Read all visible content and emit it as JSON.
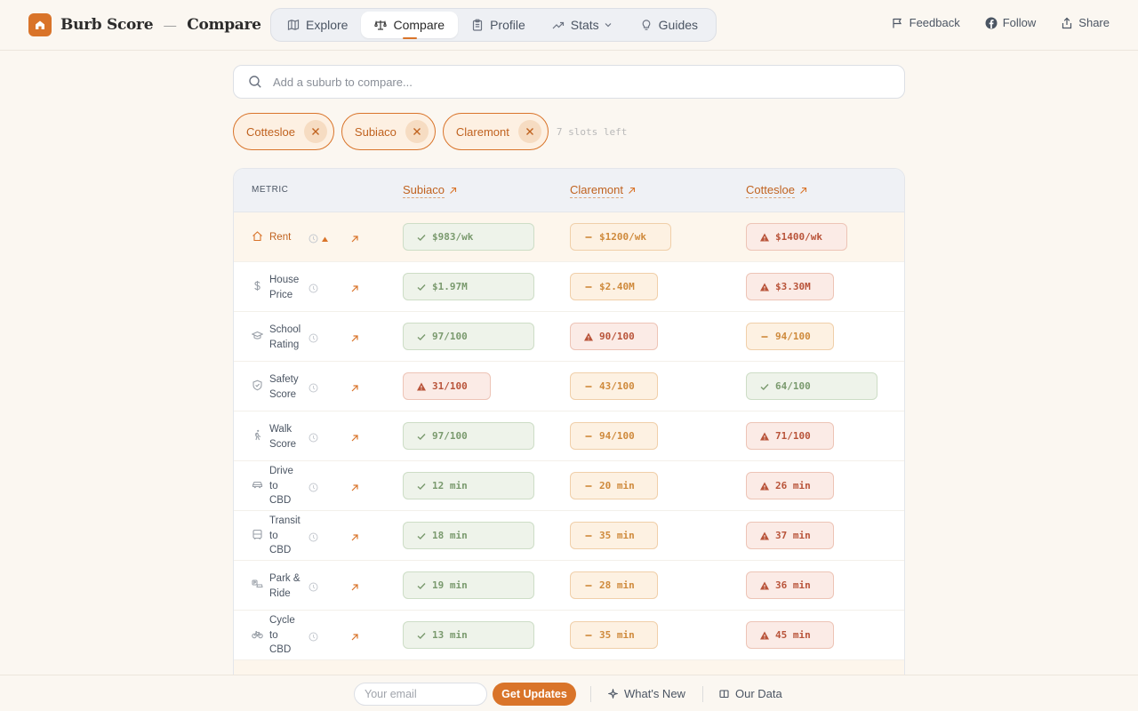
{
  "app": {
    "name": "Burb Score",
    "separator": "—",
    "page": "Compare"
  },
  "nav": [
    {
      "label": "Explore",
      "icon": "map-icon",
      "active": false
    },
    {
      "label": "Compare",
      "icon": "scale-icon",
      "active": true
    },
    {
      "label": "Profile",
      "icon": "clipboard-icon",
      "active": false
    },
    {
      "label": "Stats",
      "icon": "trending-icon",
      "active": false,
      "dropdown": true
    },
    {
      "label": "Guides",
      "icon": "lightbulb-icon",
      "active": false
    }
  ],
  "topright": {
    "feedback": "Feedback",
    "follow": "Follow",
    "share": "Share"
  },
  "search": {
    "placeholder": "Add a suburb to compare..."
  },
  "chips": [
    {
      "label": "Cottesloe"
    },
    {
      "label": "Subiaco"
    },
    {
      "label": "Claremont"
    }
  ],
  "slots_left": "7 slots left",
  "table": {
    "metric_header": "METRIC",
    "columns": [
      "Subiaco",
      "Claremont",
      "Cottesloe"
    ],
    "rows": [
      {
        "name": "Rent",
        "lines": [
          "Rent"
        ],
        "icon": "home-icon",
        "highlight": true,
        "sorted": true,
        "cells": [
          {
            "value": "$983/wk",
            "status": "good"
          },
          {
            "value": "$1200/wk",
            "status": "mid"
          },
          {
            "value": "$1400/wk",
            "status": "bad"
          }
        ]
      },
      {
        "name": "House Price",
        "lines": [
          "House",
          "Price"
        ],
        "icon": "dollar-icon",
        "cells": [
          {
            "value": "$1.97M",
            "status": "good"
          },
          {
            "value": "$2.40M",
            "status": "mid"
          },
          {
            "value": "$3.30M",
            "status": "bad"
          }
        ]
      },
      {
        "name": "School Rating",
        "lines": [
          "School",
          "Rating"
        ],
        "icon": "graduation-cap-icon",
        "cells": [
          {
            "value": "97/100",
            "status": "good"
          },
          {
            "value": "90/100",
            "status": "bad"
          },
          {
            "value": "94/100",
            "status": "mid"
          }
        ]
      },
      {
        "name": "Safety Score",
        "lines": [
          "Safety",
          "Score"
        ],
        "icon": "shield-icon",
        "cells": [
          {
            "value": "31/100",
            "status": "bad"
          },
          {
            "value": "43/100",
            "status": "mid"
          },
          {
            "value": "64/100",
            "status": "good"
          }
        ]
      },
      {
        "name": "Walk Score",
        "lines": [
          "Walk",
          "Score"
        ],
        "icon": "walking-icon",
        "cells": [
          {
            "value": "97/100",
            "status": "good"
          },
          {
            "value": "94/100",
            "status": "mid"
          },
          {
            "value": "71/100",
            "status": "bad"
          }
        ]
      },
      {
        "name": "Drive to CBD",
        "lines": [
          "Drive",
          "to",
          "CBD"
        ],
        "icon": "car-icon",
        "cells": [
          {
            "value": "12 min",
            "status": "good"
          },
          {
            "value": "20 min",
            "status": "mid"
          },
          {
            "value": "26 min",
            "status": "bad"
          }
        ]
      },
      {
        "name": "Transit to CBD",
        "lines": [
          "Transit",
          "to",
          "CBD"
        ],
        "icon": "bus-icon",
        "cells": [
          {
            "value": "18 min",
            "status": "good"
          },
          {
            "value": "35 min",
            "status": "mid"
          },
          {
            "value": "37 min",
            "status": "bad"
          }
        ]
      },
      {
        "name": "Park & Ride",
        "lines": [
          "Park &",
          "Ride"
        ],
        "icon": "park-ride-icon",
        "cells": [
          {
            "value": "19 min",
            "status": "good"
          },
          {
            "value": "28 min",
            "status": "mid"
          },
          {
            "value": "36 min",
            "status": "bad"
          }
        ]
      },
      {
        "name": "Cycle to CBD",
        "lines": [
          "Cycle",
          "to",
          "CBD"
        ],
        "icon": "bicycle-icon",
        "cells": [
          {
            "value": "13 min",
            "status": "good"
          },
          {
            "value": "35 min",
            "status": "mid"
          },
          {
            "value": "45 min",
            "status": "bad"
          }
        ]
      }
    ]
  },
  "footer": {
    "email_placeholder": "Your email",
    "cta": "Get Updates",
    "whats_new": "What's New",
    "our_data": "Our Data"
  },
  "colors": {
    "accent": "#d9742a",
    "good": "#7a9a6e",
    "mid": "#cf8a3c",
    "bad": "#b9543a"
  }
}
